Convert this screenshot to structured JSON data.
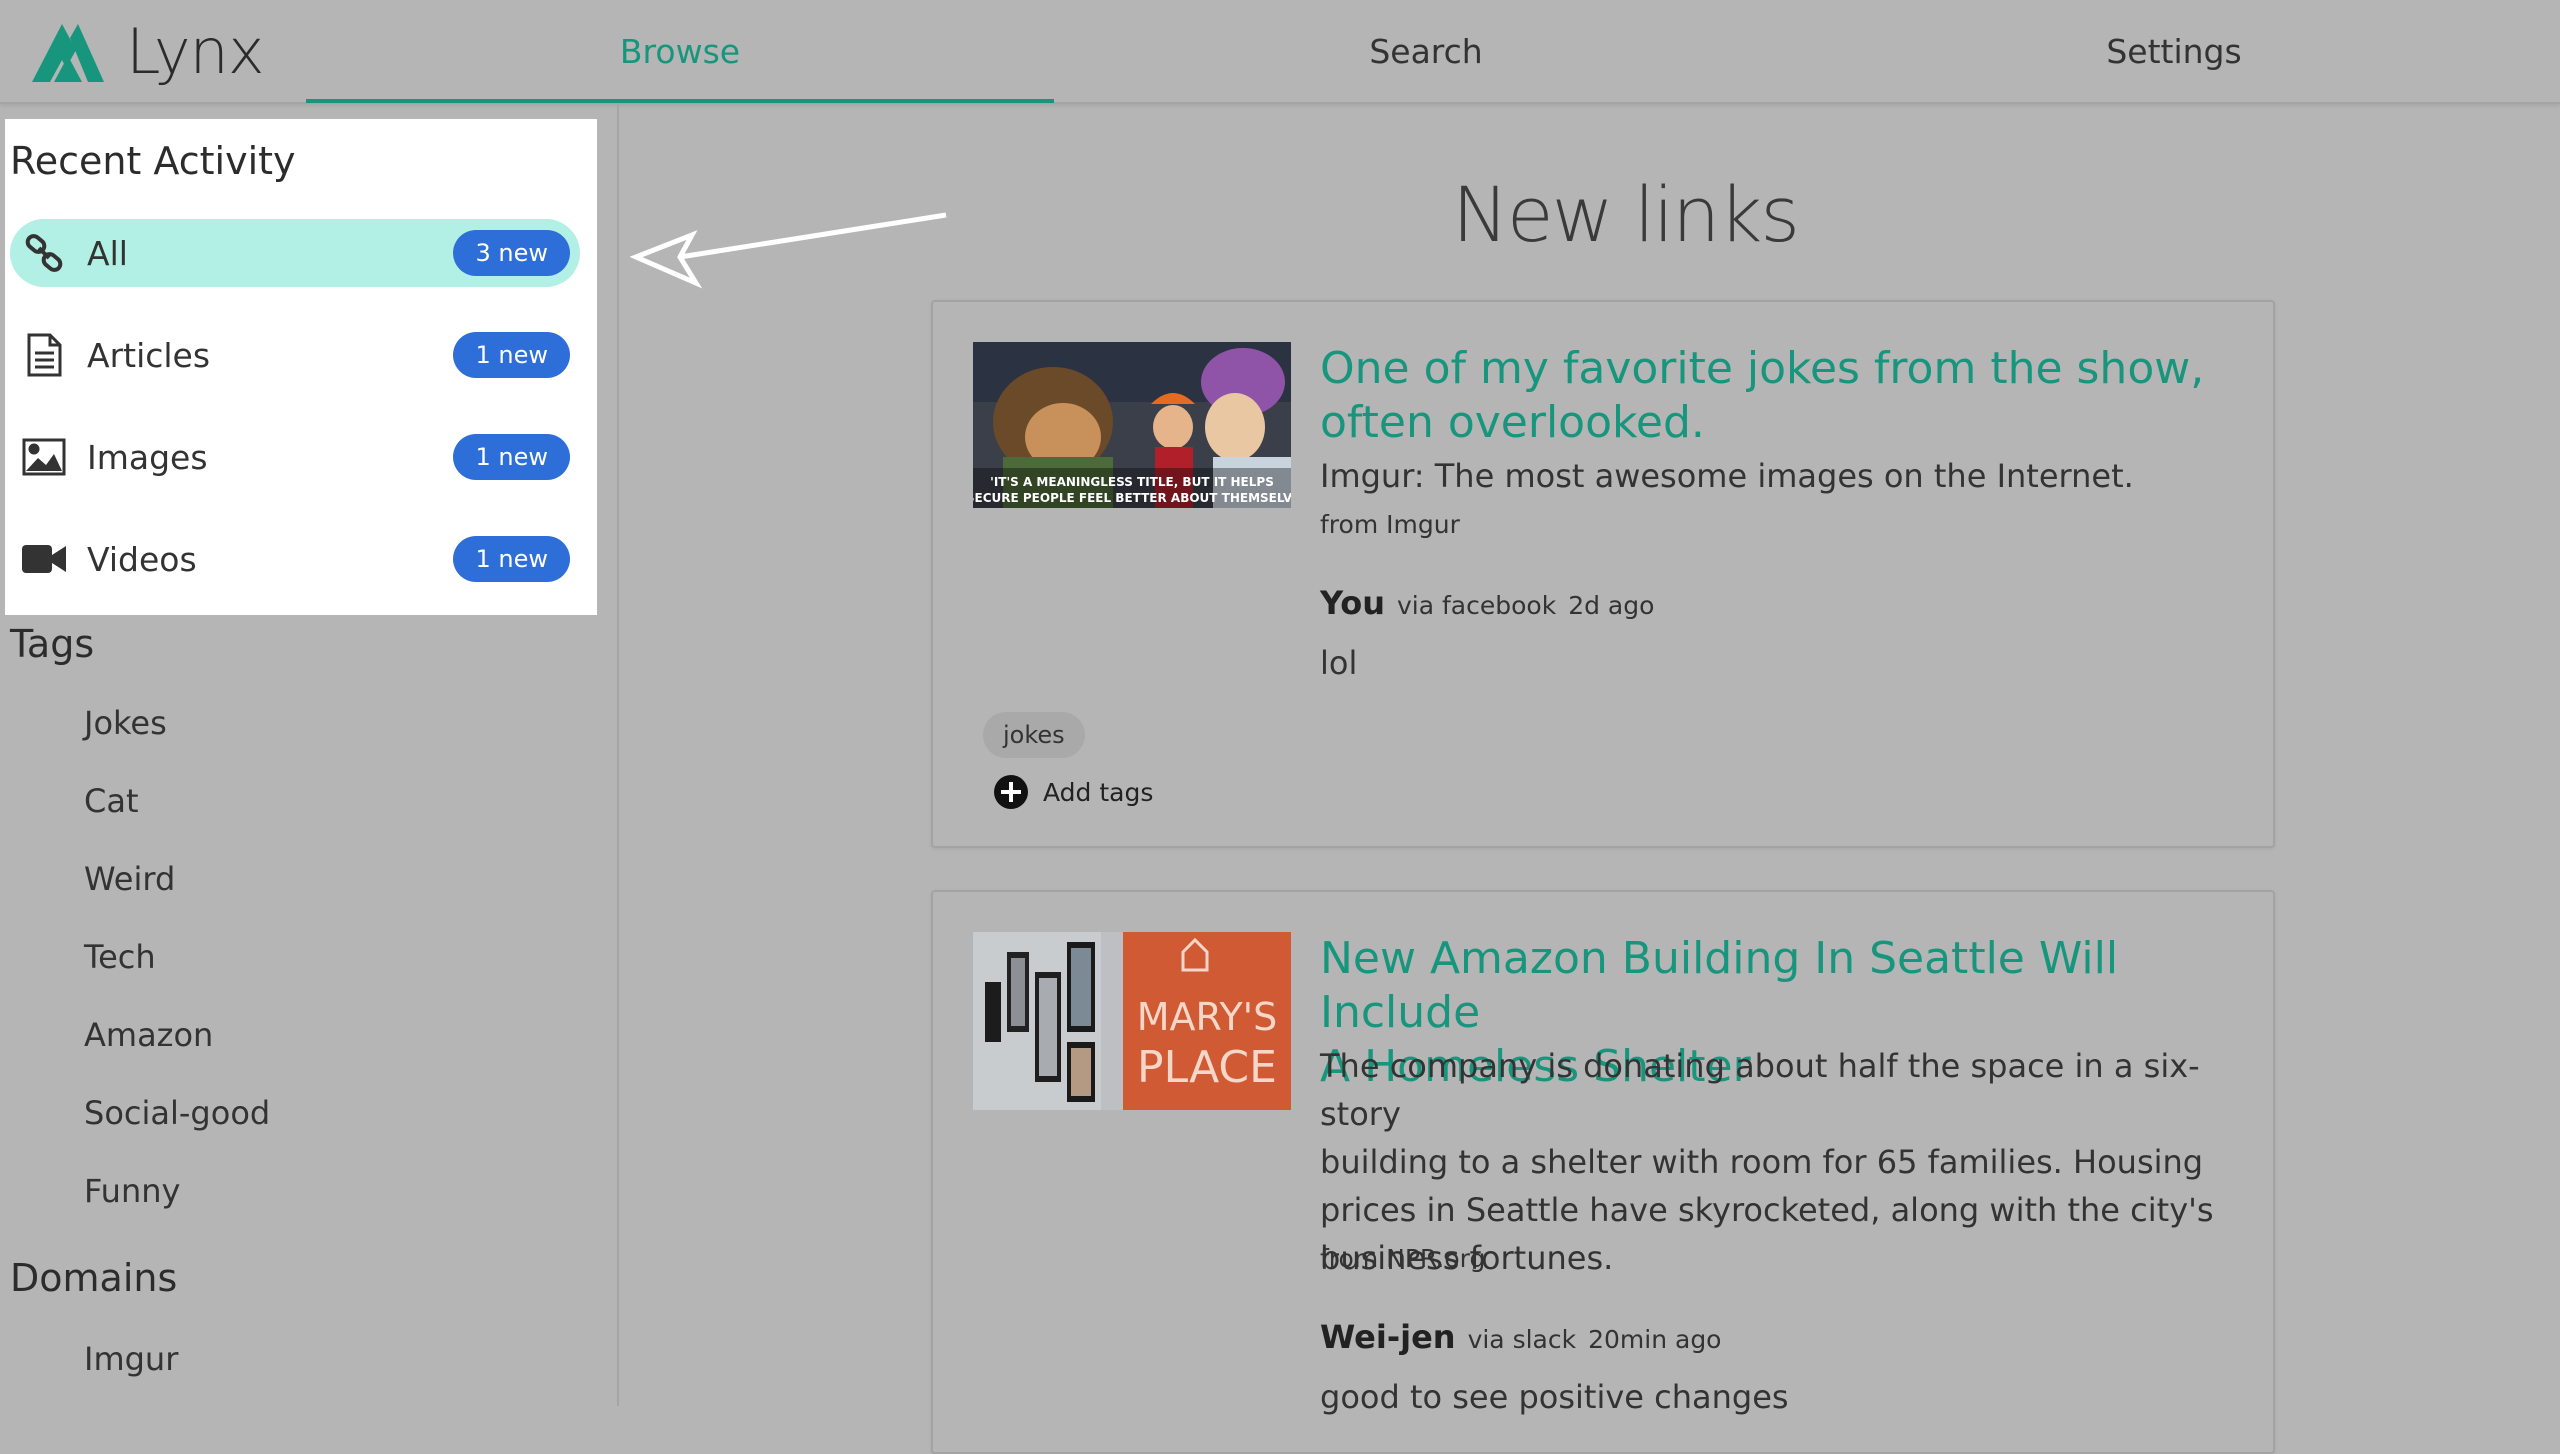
{
  "app": {
    "brand": "Lynx",
    "accent": "#17967d"
  },
  "nav": {
    "tabs": [
      {
        "label": "Browse",
        "active": true
      },
      {
        "label": "Search",
        "active": false
      },
      {
        "label": "Settings",
        "active": false
      }
    ]
  },
  "sidebar": {
    "recent_title": "Recent Activity",
    "activity": [
      {
        "label": "All",
        "badge": "3 new",
        "icon": "link-icon",
        "selected": true
      },
      {
        "label": "Articles",
        "badge": "1 new",
        "icon": "document-icon",
        "selected": false
      },
      {
        "label": "Images",
        "badge": "1 new",
        "icon": "image-icon",
        "selected": false
      },
      {
        "label": "Videos",
        "badge": "1 new",
        "icon": "video-camera-icon",
        "selected": false
      }
    ],
    "tags_title": "Tags",
    "tags": [
      "Jokes",
      "Cat",
      "Weird",
      "Tech",
      "Amazon",
      "Social-good",
      "Funny"
    ],
    "domains_title": "Domains",
    "domains": [
      "Imgur"
    ]
  },
  "main": {
    "title": "New links",
    "links": [
      {
        "title_line1": "One of my favorite jokes from the show,",
        "title_line2": "often overlooked.",
        "description": "Imgur: The most awesome images on the Internet.",
        "source": "from Imgur",
        "user": "You",
        "via": "via facebook",
        "time": "2d ago",
        "comment": "lol",
        "tags": [
          "jokes"
        ],
        "add_tags_label": "Add tags",
        "thumb_caption_1": "'IT'S A MEANINGLESS TITLE, BUT IT HELPS",
        "thumb_caption_2": "INSECURE PEOPLE FEEL BETTER ABOUT THEMSELVES'"
      },
      {
        "title_line1": "New Amazon Building In Seattle Will Include",
        "title_line2": "A Homeless Shelter",
        "description_lines": [
          "The company is donating about half the space in a six-story",
          "building to a shelter with room for 65 families. Housing",
          "prices in Seattle have skyrocketed, along with the city's",
          "business fortunes."
        ],
        "source": "from NPR.org",
        "user": "Wei-jen",
        "via": "via slack",
        "time": "20min ago",
        "comment": "good to see positive changes",
        "thumb_sign_1": "MARY'S",
        "thumb_sign_2": "PLACE"
      }
    ]
  }
}
